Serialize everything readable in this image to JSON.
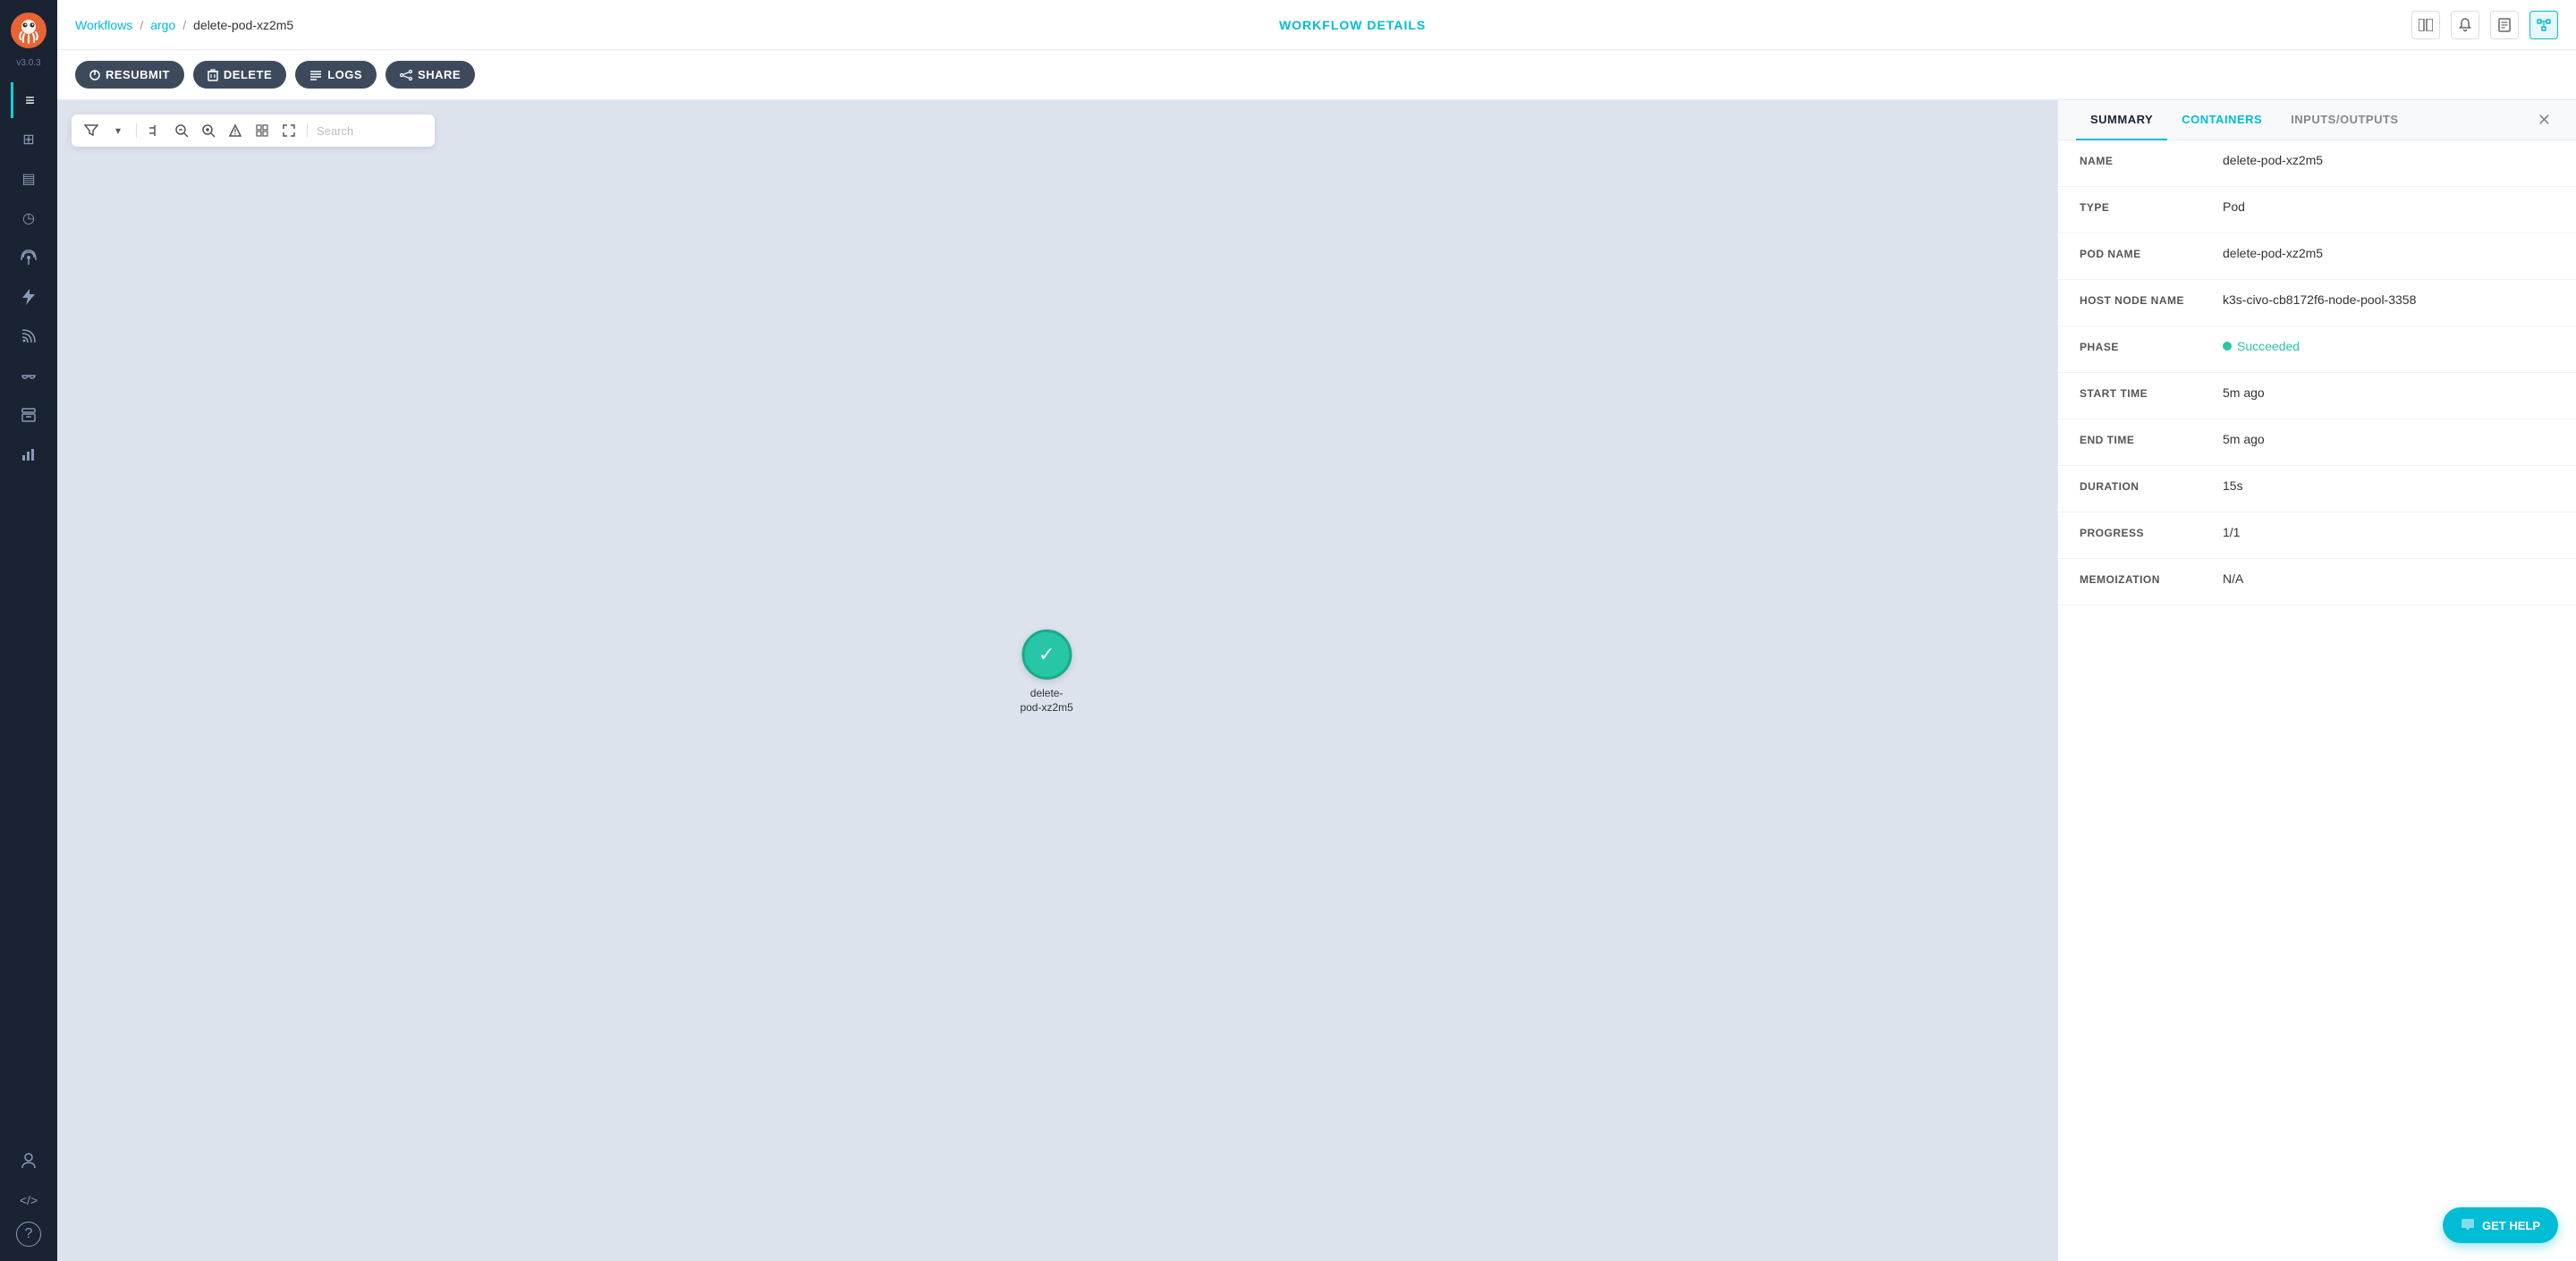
{
  "app": {
    "version": "v3.0.3",
    "header_title": "WORKFLOW DETAILS"
  },
  "breadcrumb": {
    "workflows": "Workflows",
    "argo": "argo",
    "current": "delete-pod-xz2m5"
  },
  "toolbar": {
    "resubmit": "RESUBMIT",
    "delete": "DELETE",
    "logs": "LOGS",
    "share": "SHARE"
  },
  "graph": {
    "search_placeholder": "Search",
    "node_label": "delete-\npod-xz2m5"
  },
  "details": {
    "tabs": [
      {
        "id": "summary",
        "label": "SUMMARY",
        "active": true
      },
      {
        "id": "containers",
        "label": "CONTAINERS",
        "active": false
      },
      {
        "id": "inputs_outputs",
        "label": "INPUTS/OUTPUTS",
        "active": false
      }
    ],
    "rows": [
      {
        "label": "NAME",
        "value": "delete-pod-xz2m5"
      },
      {
        "label": "TYPE",
        "value": "Pod"
      },
      {
        "label": "POD NAME",
        "value": "delete-pod-xz2m5"
      },
      {
        "label": "HOST NODE NAME",
        "value": "k3s-civo-cb8172f6-node-pool-3358"
      },
      {
        "label": "PHASE",
        "value": "Succeeded",
        "type": "phase"
      },
      {
        "label": "START TIME",
        "value": "5m ago"
      },
      {
        "label": "END TIME",
        "value": "5m ago"
      },
      {
        "label": "DURATION",
        "value": "15s"
      },
      {
        "label": "PROGRESS",
        "value": "1/1"
      },
      {
        "label": "MEMOIZATION",
        "value": "N/A"
      }
    ]
  },
  "sidebar": {
    "items": [
      {
        "id": "menu",
        "icon": "≡",
        "active": true
      },
      {
        "id": "grid",
        "icon": "⊞"
      },
      {
        "id": "layers",
        "icon": "▤"
      },
      {
        "id": "clock",
        "icon": "◷"
      },
      {
        "id": "antenna",
        "icon": "⚡"
      },
      {
        "id": "bolt",
        "icon": "⚡"
      },
      {
        "id": "rss",
        "icon": "◎"
      },
      {
        "id": "link",
        "icon": "🔗"
      },
      {
        "id": "archive",
        "icon": "▣"
      },
      {
        "id": "chart",
        "icon": "▦"
      },
      {
        "id": "user",
        "icon": "👤"
      },
      {
        "id": "code",
        "icon": "⟨⟩"
      },
      {
        "id": "help",
        "icon": "?"
      }
    ]
  },
  "get_help": {
    "label": "GET HELP",
    "icon": "💬"
  }
}
